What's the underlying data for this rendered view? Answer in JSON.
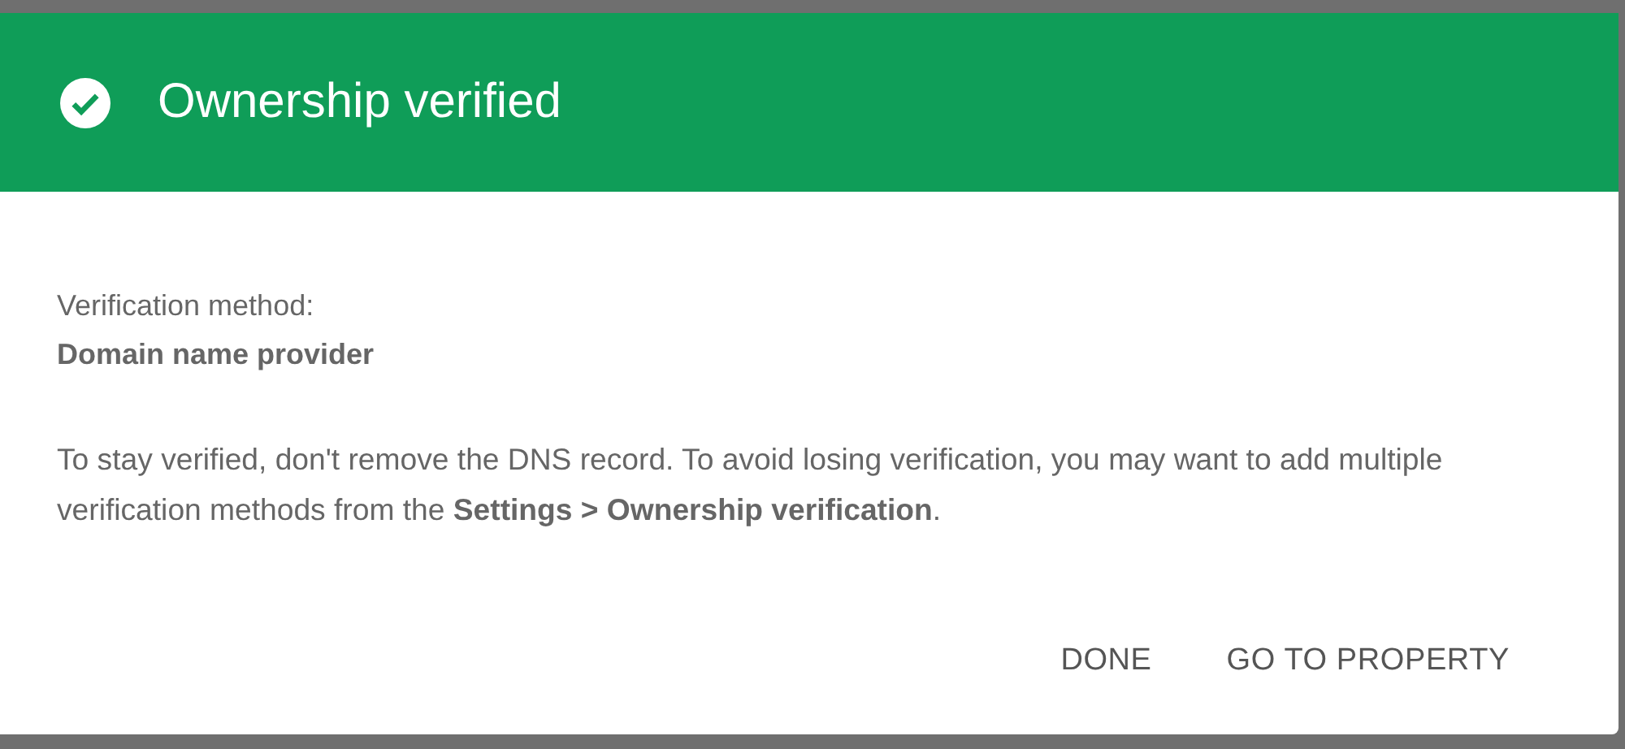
{
  "dialog": {
    "title": "Ownership verified",
    "method_label": "Verification method:",
    "method_value": "Domain name provider",
    "message": "To stay verified, don't remove the DNS record. To avoid losing verification, you may want to add multiple verification methods from the **Settings > Ownership verification**.",
    "buttons": [
      {
        "label": "DONE"
      },
      {
        "label": "GO TO PROPERTY"
      }
    ]
  }
}
